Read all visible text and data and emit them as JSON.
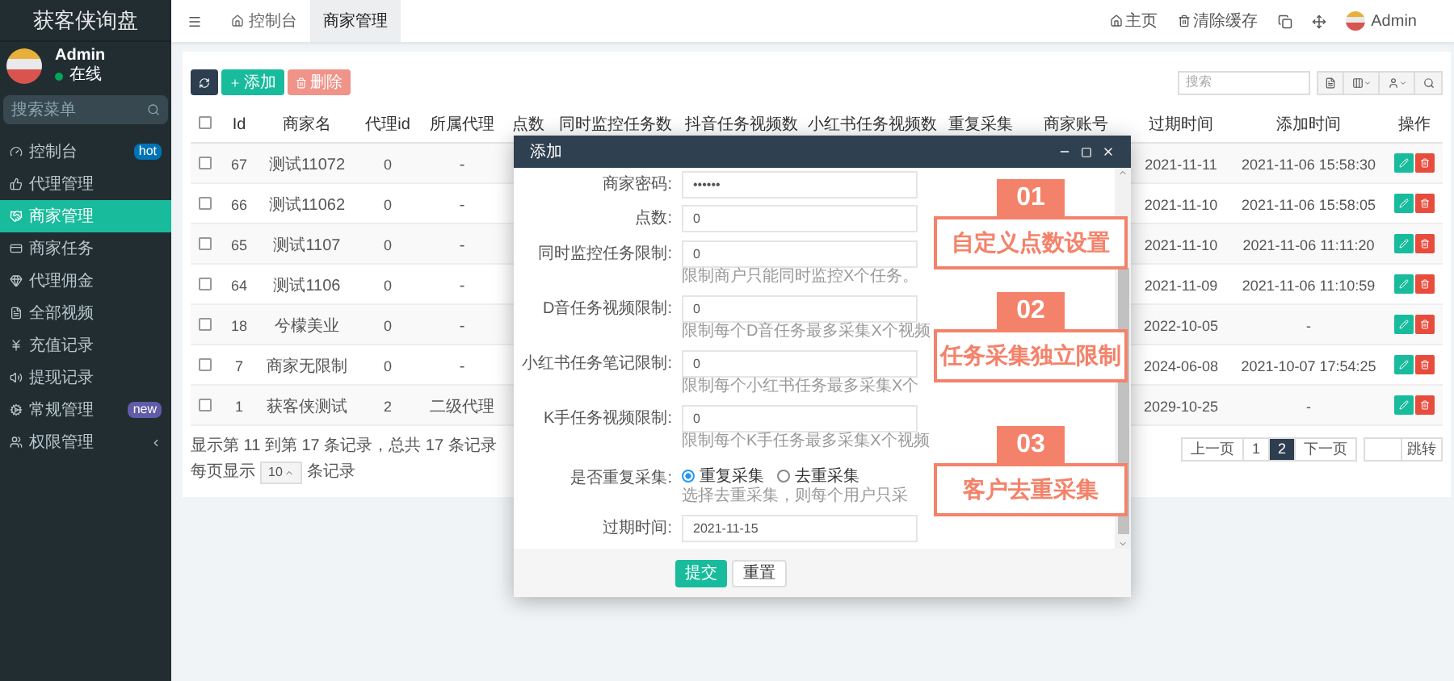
{
  "sidebar": {
    "title": "获客侠询盘",
    "user": {
      "name": "Admin",
      "status": "在线"
    },
    "search": {
      "placeholder": "搜索菜单"
    },
    "items": [
      {
        "label": "控制台",
        "selected": false,
        "badge": {
          "text": "hot",
          "color": "#0073b7"
        }
      },
      {
        "label": "代理管理",
        "selected": false
      },
      {
        "label": "商家管理",
        "selected": true
      },
      {
        "label": "商家任务",
        "selected": false
      },
      {
        "label": "代理佣金",
        "selected": false
      },
      {
        "label": "全部视频",
        "selected": false
      },
      {
        "label": "充值记录",
        "selected": false
      },
      {
        "label": "提现记录",
        "selected": false
      },
      {
        "label": "常规管理",
        "selected": false,
        "badge": {
          "text": "new",
          "color": "#605ca8"
        }
      },
      {
        "label": "权限管理",
        "selected": false,
        "expandable": true
      }
    ]
  },
  "topbar": {
    "tabs": [
      {
        "label": "控制台",
        "selected": false
      },
      {
        "label": "商家管理",
        "selected": true
      }
    ],
    "links": [
      "主页",
      "清除缓存"
    ],
    "user": "Admin"
  },
  "toolbar": {
    "buttons": [
      {
        "kind": "refresh"
      },
      {
        "kind": "add",
        "label": "添加"
      },
      {
        "kind": "delete",
        "label": "删除",
        "disabled": true
      }
    ],
    "search": {
      "placeholder": "搜索"
    }
  },
  "table": {
    "all_checked": false,
    "columns": [
      "Id",
      "商家名",
      "代理id",
      "所属代理",
      "点数",
      "同时监控任务数",
      "抖音任务视频数",
      "小红书任务视频数",
      "重复采集",
      "商家账号",
      "过期时间",
      "添加时间",
      "操作"
    ],
    "rows": [
      {
        "checked": false,
        "id": "67",
        "name": "测试11072",
        "agent_id": "0",
        "agent": "-",
        "expires": "2021-11-11",
        "added": "2021-11-06 15:58:30"
      },
      {
        "checked": false,
        "id": "66",
        "name": "测试11062",
        "agent_id": "0",
        "agent": "-",
        "expires": "2021-11-10",
        "added": "2021-11-06 15:58:05"
      },
      {
        "checked": false,
        "id": "65",
        "name": "测试1107",
        "agent_id": "0",
        "agent": "-",
        "expires": "2021-11-10",
        "added": "2021-11-06 11:11:20"
      },
      {
        "checked": false,
        "id": "64",
        "name": "测试1106",
        "agent_id": "0",
        "agent": "-",
        "expires": "2021-11-09",
        "added": "2021-11-06 11:10:59"
      },
      {
        "checked": false,
        "id": "18",
        "name": "兮檬美业",
        "agent_id": "0",
        "agent": "-",
        "expires": "2022-10-05",
        "added": "-"
      },
      {
        "checked": false,
        "id": "7",
        "name": "商家无限制",
        "agent_id": "0",
        "agent": "-",
        "expires": "2024-06-08",
        "added": "2021-10-07 17:54:25"
      },
      {
        "checked": false,
        "id": "1",
        "name": "获客侠测试",
        "agent_id": "2",
        "agent": "二级代理",
        "expires": "2029-10-25",
        "added": "-"
      }
    ]
  },
  "pagination": {
    "summary": "显示第 11 到第 17 条记录，总共 17 条记录",
    "per_page_label": "每页显示",
    "per_page": "10",
    "per_page_suffix": "条记录",
    "pages": [
      {
        "label": "上一页",
        "selected": false
      },
      {
        "label": "1",
        "selected": false
      },
      {
        "label": "2",
        "selected": true
      },
      {
        "label": "下一页",
        "selected": false
      }
    ],
    "jump_button": "跳转"
  },
  "modal": {
    "title": "添加",
    "fields": [
      {
        "kind": "text",
        "label": "商家密码:",
        "value": "••••••"
      },
      {
        "kind": "text",
        "label": "点数:",
        "value": "0"
      },
      {
        "kind": "text",
        "label": "同时监控任务限制:",
        "value": "0",
        "hint": "限制商户只能同时监控X个任务。"
      },
      {
        "kind": "text",
        "label": "D音任务视频限制:",
        "value": "0",
        "hint": "限制每个D音任务最多采集X个视频"
      },
      {
        "kind": "text",
        "label": "小红书任务笔记限制:",
        "value": "0",
        "hint": "限制每个小红书任务最多采集X个"
      },
      {
        "kind": "text",
        "label": "K手任务视频限制:",
        "value": "0",
        "hint": "限制每个K手任务最多采集X个视频"
      },
      {
        "kind": "radio",
        "label": "是否重复采集:",
        "options": [
          {
            "label": "重复采集",
            "selected": true
          },
          {
            "label": "去重采集",
            "selected": false
          }
        ],
        "hint": "选择去重采集，则每个用户只采"
      },
      {
        "kind": "text",
        "label": "过期时间:",
        "value": "2021-11-15"
      }
    ],
    "buttons": [
      "提交",
      "重置"
    ]
  },
  "callouts": [
    {
      "number": "01",
      "text": "自定义点数设置"
    },
    {
      "number": "02",
      "text": "任务采集独立限制"
    },
    {
      "number": "03",
      "text": "客户去重采集"
    }
  ]
}
